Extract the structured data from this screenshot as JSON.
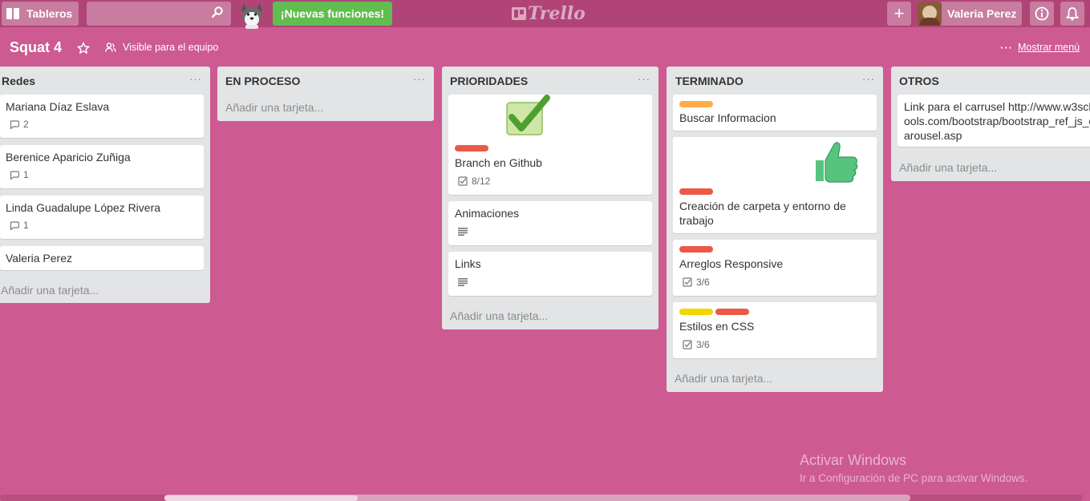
{
  "header": {
    "boards_label": "Tableros",
    "search_placeholder": "",
    "new_features": "¡Nuevas funciones!",
    "logo_text": "Trello",
    "user_name": "Valeria Perez",
    "add_icon": "plus-icon",
    "info_icon": "info-icon",
    "bell_icon": "bell-icon"
  },
  "board": {
    "title": "Squat 4",
    "visibility": "Visible para el equipo",
    "menu_dots": "···",
    "show_menu": "Mostrar menú",
    "background": "#cd5a91"
  },
  "lists": [
    {
      "title": "Redes",
      "dots": "···",
      "add_card": "Añadir una tarjeta...",
      "cards": [
        {
          "title": "Mariana Díaz Eslava",
          "comments": "2"
        },
        {
          "title": "Berenice Aparicio Zuñiga",
          "comments": "1"
        },
        {
          "title": "Linda Guadalupe López Rivera",
          "comments": "1"
        },
        {
          "title": "Valeria Perez"
        }
      ]
    },
    {
      "title": "EN PROCESO",
      "dots": "···",
      "add_card": "Añadir una tarjeta...",
      "cards": []
    },
    {
      "title": "PRIORIDADES",
      "dots": "···",
      "add_card": "Añadir una tarjeta...",
      "cards": [
        {
          "title": "Branch en Github",
          "checklist": "8/12",
          "labels": [
            "#eb5a46"
          ],
          "cover_icon": "checkmark-icon"
        },
        {
          "title": "Animaciones",
          "description": true
        },
        {
          "title": "Links",
          "description": true
        }
      ]
    },
    {
      "title": "TERMINADO",
      "dots": "···",
      "add_card": "Añadir una tarjeta...",
      "cards": [
        {
          "title": "Buscar Informacion",
          "labels": [
            "#ffab4a"
          ]
        },
        {
          "title": "Creación de carpeta y entorno de trabajo",
          "labels": [
            "#eb5a46"
          ],
          "cover_icon": "thumbs-up-icon"
        },
        {
          "title": "Arreglos Responsive",
          "checklist": "3/6",
          "labels": [
            "#eb5a46"
          ]
        },
        {
          "title": "Estilos en CSS",
          "checklist": "3/6",
          "labels": [
            "#f2d600",
            "#eb5a46"
          ]
        }
      ]
    },
    {
      "title": "OTROS",
      "dots": "",
      "add_card": "Añadir una tarjeta...",
      "cards": [
        {
          "title": "Link para el carrusel http://www.w3schools.com/bootstrap/bootstrap_ref_js_carousel.asp"
        }
      ]
    }
  ],
  "watermark": {
    "line1": "Activar Windows",
    "line2": "Ir a Configuración de PC para activar Windows."
  }
}
